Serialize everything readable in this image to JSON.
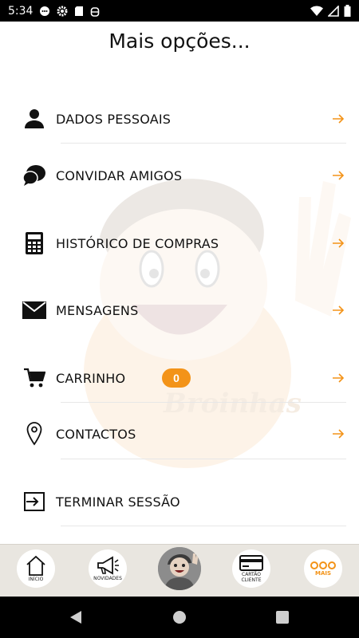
{
  "status_bar": {
    "time": "5:34"
  },
  "page": {
    "title": "Mais opções..."
  },
  "menu": [
    {
      "label": "DADOS PESSOAIS",
      "icon": "person-icon"
    },
    {
      "label": "CONVIDAR AMIGOS",
      "icon": "chat-bubbles-icon"
    },
    {
      "label": "HISTÓRICO DE COMPRAS",
      "icon": "calculator-icon"
    },
    {
      "label": "MENSAGENS",
      "icon": "envelope-icon"
    },
    {
      "label": "CARRINHO",
      "icon": "cart-icon",
      "badge": "0"
    },
    {
      "label": "CONTACTOS",
      "icon": "location-pin-icon"
    },
    {
      "label": "TERMINAR SESSÃO",
      "icon": "logout-icon"
    }
  ],
  "watermark_text": "Broinhas",
  "bottom_nav": {
    "inicio": "INÍCIO",
    "novidades": "NOVIDADES",
    "cartao_line1": "CARTÃO",
    "cartao_line2": "CLIENTE",
    "mais": "MAIS"
  },
  "colors": {
    "accent": "#f39318",
    "nav_bg": "#e9e6e0"
  }
}
